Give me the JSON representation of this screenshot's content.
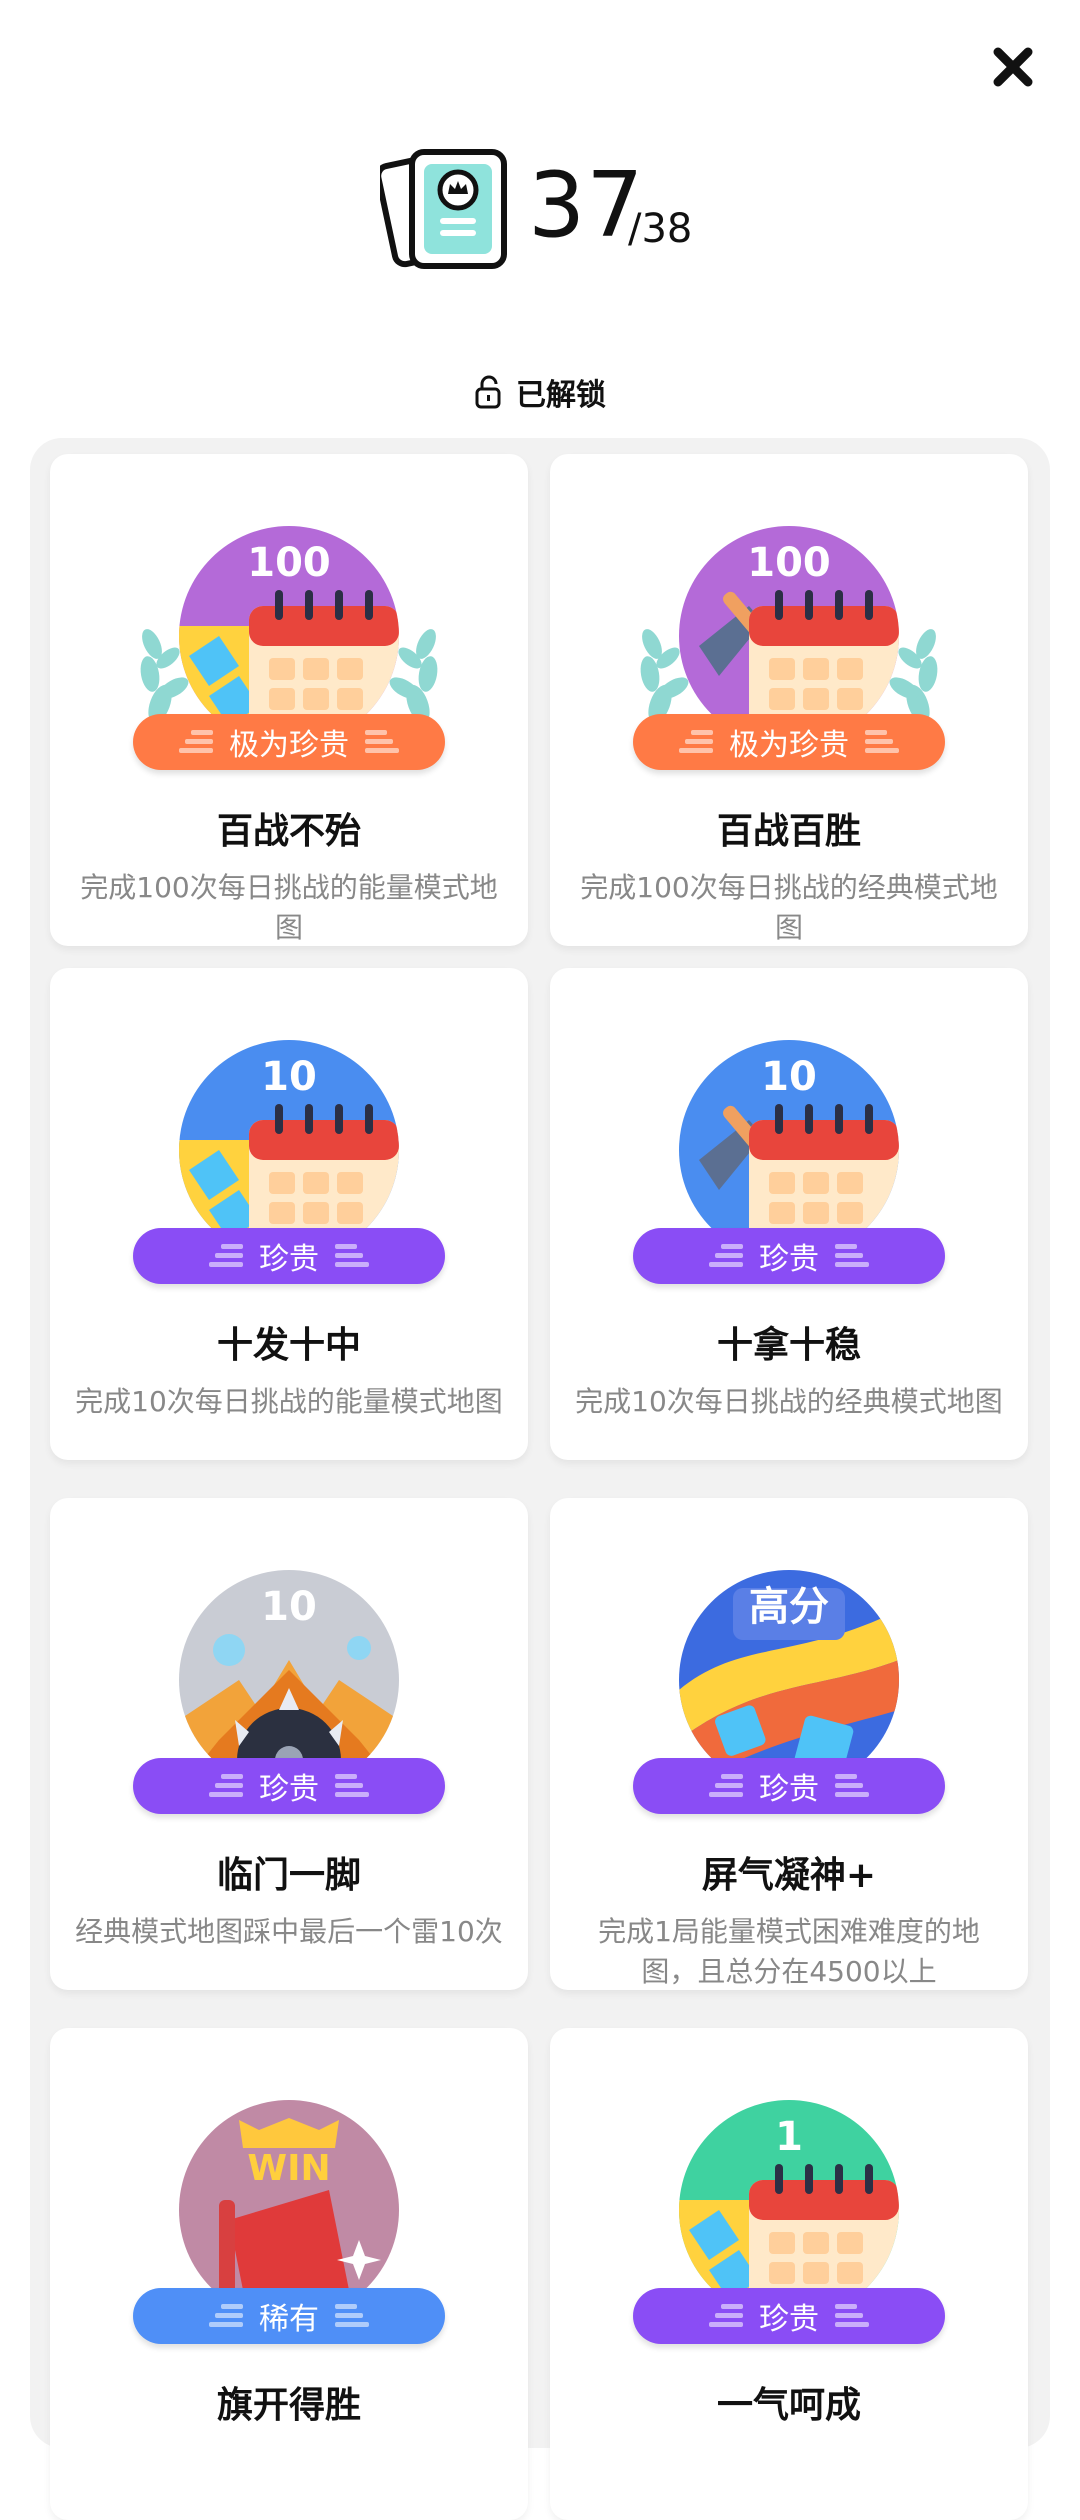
{
  "header": {
    "count": "37",
    "total": "/38",
    "unlocked_label": "已解锁"
  },
  "colors": {
    "legendary": "#ff7a45",
    "precious": "#8a4df5",
    "rare": "#4f8ff7"
  },
  "achievements": [
    {
      "title": "百战不殆",
      "description": "完成100次每日挑战的能量模式地图",
      "rarity": "极为珍贵",
      "badge_number": "100",
      "icon": "energy-calendar-badge-icon"
    },
    {
      "title": "百战百胜",
      "description": "完成100次每日挑战的经典模式地图",
      "rarity": "极为珍贵",
      "badge_number": "100",
      "icon": "shovel-calendar-badge-icon"
    },
    {
      "title": "十发十中",
      "description": "完成10次每日挑战的能量模式地图",
      "rarity": "珍贵",
      "badge_number": "10",
      "icon": "energy-calendar-badge-icon"
    },
    {
      "title": "十拿十稳",
      "description": "完成10次每日挑战的经典模式地图",
      "rarity": "珍贵",
      "badge_number": "10",
      "icon": "shovel-calendar-badge-icon"
    },
    {
      "title": "临门一脚",
      "description": "经典模式地图踩中最后一个雷10次",
      "rarity": "珍贵",
      "badge_number": "10",
      "icon": "mine-explosion-badge-icon"
    },
    {
      "title": "屏气凝神+",
      "description": "完成1局能量模式困难难度的地图，且总分在4500以上",
      "rarity": "珍贵",
      "badge_number": "高分",
      "icon": "high-score-badge-icon"
    },
    {
      "title": "旗开得胜",
      "description": "",
      "rarity": "稀有",
      "badge_number": "WIN",
      "icon": "flag-win-badge-icon"
    },
    {
      "title": "一气呵成",
      "description": "",
      "rarity": "珍贵",
      "badge_number": "1",
      "icon": "energy-calendar-badge-icon"
    }
  ]
}
